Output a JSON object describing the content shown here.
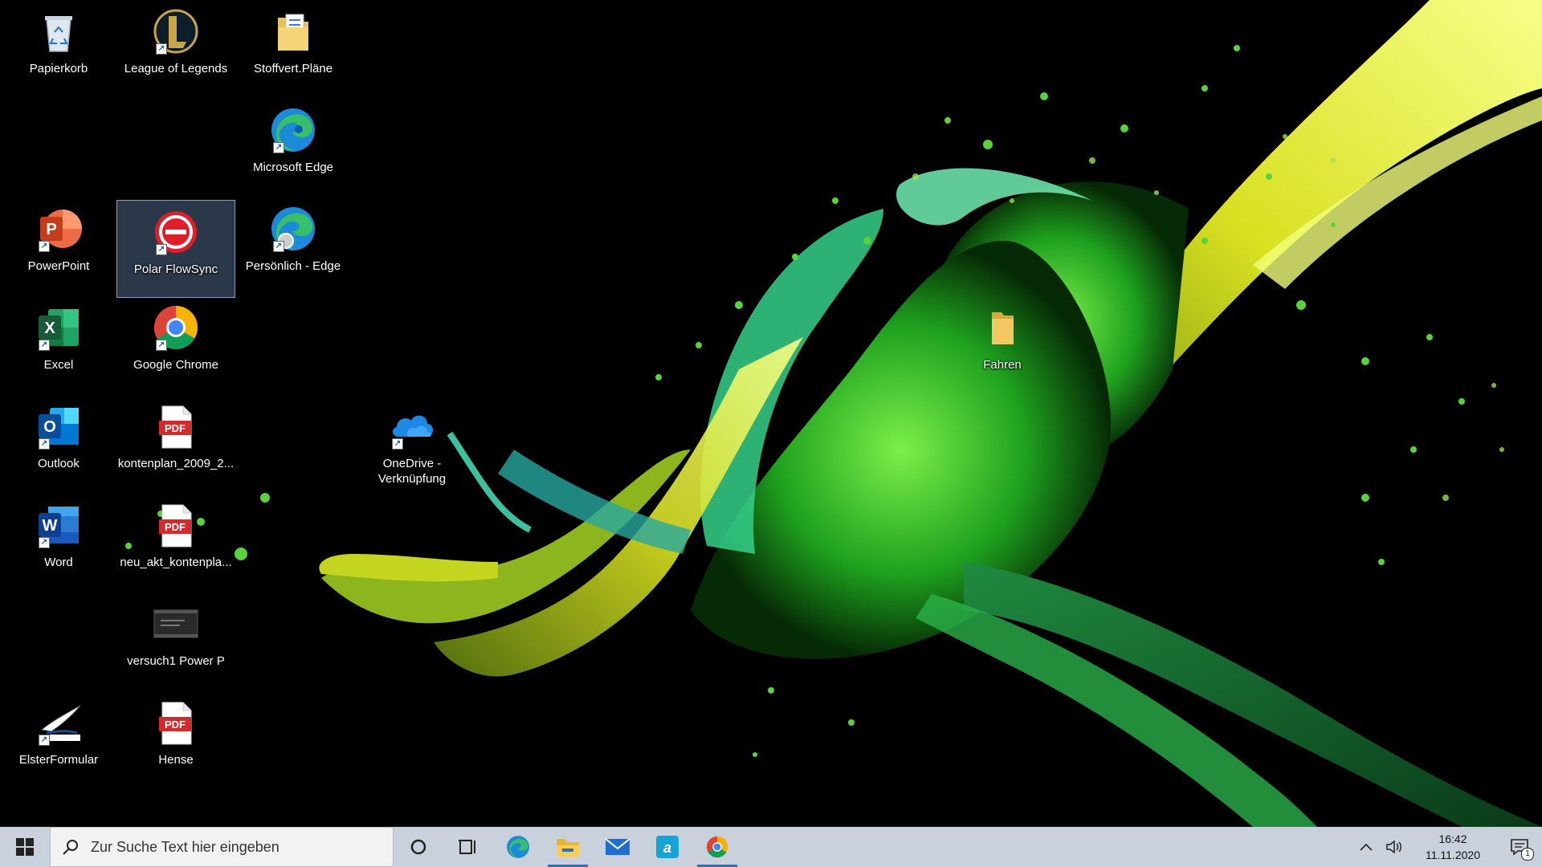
{
  "desktop": {
    "icons": [
      {
        "label": "Papierkorb",
        "icon": "recycle-bin-icon"
      },
      {
        "label": "League of Legends",
        "icon": "league-of-legends-icon"
      },
      {
        "label": "Stoffvert.Pläne",
        "icon": "folder-documents-icon"
      },
      {
        "label": "Microsoft Edge",
        "icon": "edge-icon"
      },
      {
        "label": "PowerPoint",
        "icon": "powerpoint-icon"
      },
      {
        "label": "Polar FlowSync",
        "icon": "polar-flowsync-icon",
        "selected": true
      },
      {
        "label": "Persönlich - Edge",
        "icon": "edge-profile-icon"
      },
      {
        "label": "Excel",
        "icon": "excel-icon"
      },
      {
        "label": "Google Chrome",
        "icon": "chrome-icon"
      },
      {
        "label": "Fahren",
        "icon": "folder-icon"
      },
      {
        "label": "Outlook",
        "icon": "outlook-icon"
      },
      {
        "label": "kontenplan_2009_2...",
        "icon": "pdf-icon"
      },
      {
        "label": "OneDrive - Verknüpfung",
        "icon": "onedrive-icon"
      },
      {
        "label": "Word",
        "icon": "word-icon"
      },
      {
        "label": "neu_akt_kontenpla...",
        "icon": "pdf-icon"
      },
      {
        "label": "versuch1 Power P",
        "icon": "video-file-icon"
      },
      {
        "label": "ElsterFormular",
        "icon": "elster-icon"
      },
      {
        "label": "Hense",
        "icon": "pdf-icon"
      }
    ],
    "pdf_badge": "PDF"
  },
  "taskbar": {
    "search_placeholder": "Zur Suche Text hier eingeben",
    "apps": [
      "cortana-icon",
      "task-view-icon",
      "edge-icon",
      "file-explorer-icon",
      "mail-icon",
      "aldi-talk-icon",
      "chrome-icon"
    ],
    "time": "16:42",
    "date": "11.11.2020",
    "notification_count": "1"
  },
  "colors": {
    "taskbar_bg": "#c9d2dc",
    "splash_green": "#2fd12a",
    "splash_yellow": "#d6e21b",
    "accent": "#2d6fc5"
  }
}
